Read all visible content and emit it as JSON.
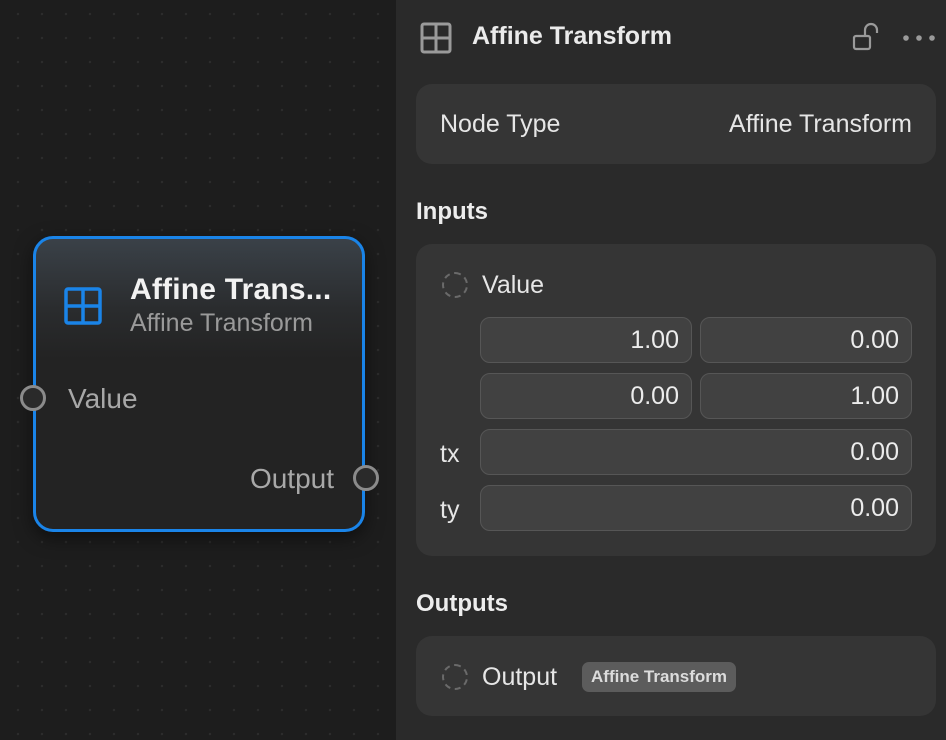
{
  "node": {
    "title": "Affine Trans...",
    "subtitle": "Affine Transform",
    "input_port_label": "Value",
    "output_port_label": "Output",
    "icon": "grid-icon",
    "accent_color": "#1a84e8"
  },
  "inspector": {
    "title": "Affine Transform",
    "icons": {
      "header": "grid-icon",
      "lock": "unlocked-padlock-icon",
      "more": "ellipsis-icon"
    },
    "node_type": {
      "label": "Node Type",
      "value": "Affine Transform"
    },
    "inputs": {
      "heading": "Inputs",
      "value_label": "Value",
      "matrix": [
        [
          "1.00",
          "0.00"
        ],
        [
          "0.00",
          "1.00"
        ]
      ],
      "tx": {
        "label": "tx",
        "value": "0.00"
      },
      "ty": {
        "label": "ty",
        "value": "0.00"
      }
    },
    "outputs": {
      "heading": "Outputs",
      "output_label": "Output",
      "output_type_badge": "Affine Transform"
    }
  }
}
